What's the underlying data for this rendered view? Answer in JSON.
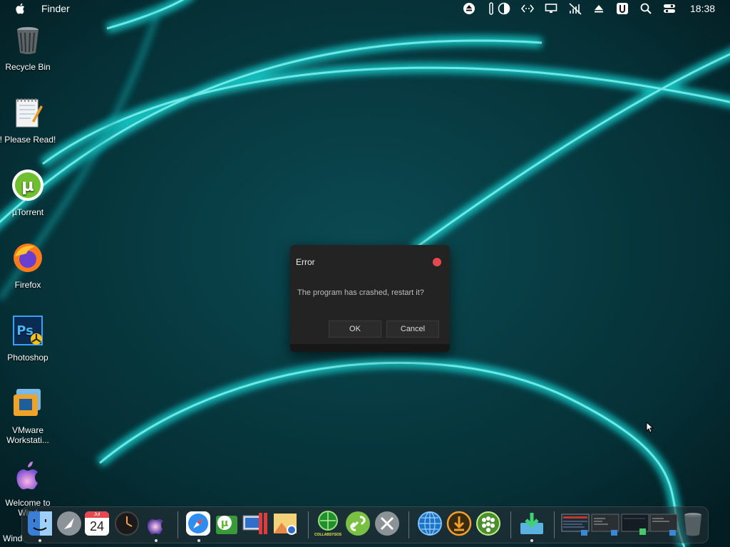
{
  "menubar": {
    "app_name": "Finder",
    "clock": "18:38",
    "tray_icons": [
      "eject-icon",
      "mic-icon",
      "half-moon-icon",
      "code-icon",
      "display-icon",
      "wifi-off-icon",
      "eject-icon",
      "u-badge-icon",
      "search-icon",
      "control-center-icon"
    ]
  },
  "desktop": {
    "icons": [
      {
        "label": "Recycle Bin",
        "icon": "recycle-bin-icon"
      },
      {
        "label": "! Please Read!",
        "icon": "notepad-icon"
      },
      {
        "label": "µTorrent",
        "icon": "utorrent-icon"
      },
      {
        "label": "Firefox",
        "icon": "firefox-icon"
      },
      {
        "label": "Photoshop",
        "icon": "photoshop-icon"
      },
      {
        "label": "VMware Workstati...",
        "icon": "vmware-icon"
      },
      {
        "label": "Welcome to Wind",
        "icon": "apple-logo-icon"
      }
    ]
  },
  "dialog": {
    "title": "Error",
    "message": "The program has crashed, restart it?",
    "ok_label": "OK",
    "cancel_label": "Cancel"
  },
  "dock": {
    "items": [
      "finder-icon",
      "launchpad-icon",
      "calendar-icon",
      "clock-icon",
      "siri-icon",
      "safari-icon",
      "utorrent-icon",
      "parallels-icon",
      "photos-icon",
      "collabsysos-icon",
      "link-icon",
      "tools-icon",
      "globe-icon",
      "download-icon",
      "drops-icon",
      "downloads-folder-icon",
      "window-thumb-icon",
      "window-thumb-icon",
      "window-thumb-icon",
      "window-thumb-icon",
      "trash-icon"
    ],
    "calendar_month": "Jul",
    "calendar_day": "24",
    "collab_label": "COLLABSYSOS"
  },
  "taskbar": {
    "label": "Wind"
  },
  "colors": {
    "accent": "#21d7d5",
    "dialog_bg": "#232323",
    "close_dot": "#e5484d"
  }
}
